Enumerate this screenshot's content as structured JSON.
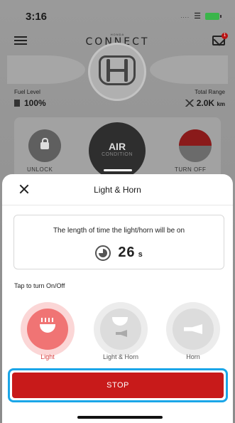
{
  "status_bar": {
    "time": "3:16",
    "signal": "....",
    "wifi": "wifi-icon",
    "battery": "battery-charging-icon"
  },
  "app_header": {
    "brand_small": "HONDA",
    "brand": "CONNECT",
    "mail_badge": "1"
  },
  "vehicle": {
    "fuel_label": "Fuel Level",
    "fuel_value": "100%",
    "range_label": "Total Range",
    "range_value": "2.0K",
    "range_unit": "km"
  },
  "controls": {
    "unlock_label": "UNLOCK",
    "air_title": "AIR",
    "air_sub": "CONDITION",
    "turnoff_label": "TURN OFF"
  },
  "sheet": {
    "title": "Light & Horn",
    "duration_desc": "The length of time the light/horn will be on",
    "duration_value": "26",
    "duration_unit": "s",
    "tap_label": "Tap to turn On/Off",
    "modes": [
      {
        "label": "Light",
        "active": true
      },
      {
        "label": "Light & Horn",
        "active": false
      },
      {
        "label": "Horn",
        "active": false
      }
    ],
    "stop_label": "STOP"
  },
  "colors": {
    "accent_red": "#c81a1a",
    "active_mode": "#f07474",
    "focus_outline": "#1ba6e8"
  }
}
